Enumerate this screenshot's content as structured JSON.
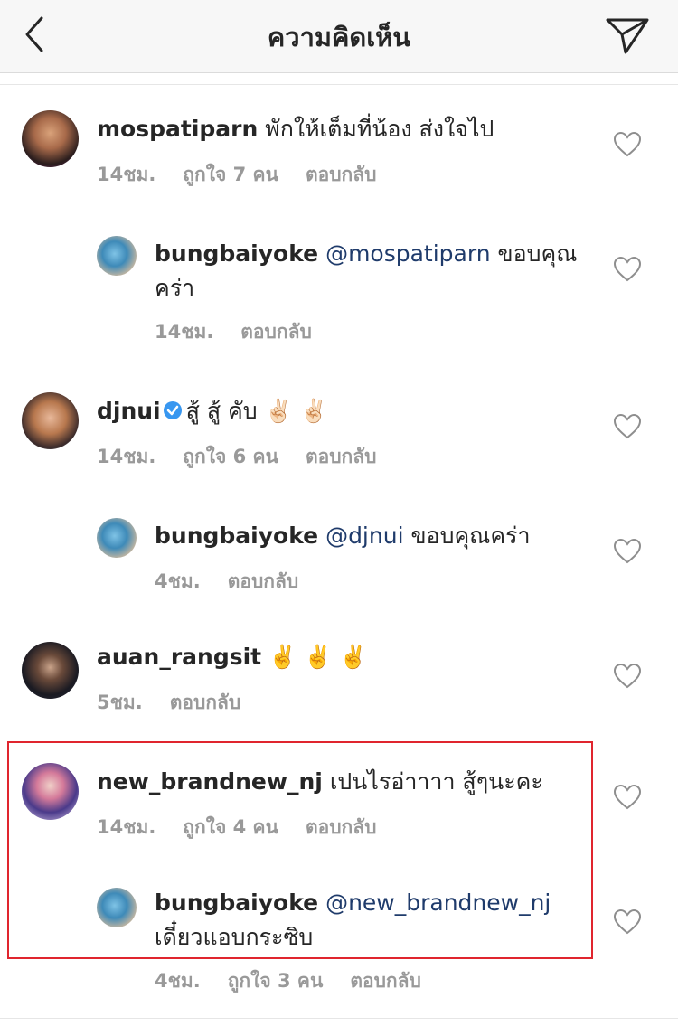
{
  "header": {
    "title": "ความคิดเห็น",
    "back_icon": "chevron-left-icon",
    "send_icon": "paper-plane-icon"
  },
  "comments": [
    {
      "username": "mospatiparn",
      "text": "พักให้เต็มที่น้อง ส่งใจไป",
      "time": "14ชม.",
      "likes": "ถูกใจ 7 คน",
      "reply": "ตอบกลับ"
    },
    {
      "username": "bungbaiyoke",
      "mention": "@mospatiparn",
      "text": "ขอบคุณคร่า",
      "time": "14ชม.",
      "reply": "ตอบกลับ"
    },
    {
      "username": "djnui",
      "verified": true,
      "text": "สู้ สู้ คับ ✌🏻 ✌🏻",
      "time": "14ชม.",
      "likes": "ถูกใจ 6 คน",
      "reply": "ตอบกลับ"
    },
    {
      "username": "bungbaiyoke",
      "mention": "@djnui",
      "text": "ขอบคุณคร่า",
      "time": "4ชม.",
      "reply": "ตอบกลับ"
    },
    {
      "username": "auan_rangsit",
      "text": "✌️ ✌️ ✌️",
      "time": "5ชม.",
      "reply": "ตอบกลับ"
    },
    {
      "username": "new_brandnew_nj",
      "text": "เปนไรอ่าาาา สู้ๆนะคะ",
      "time": "14ชม.",
      "likes": "ถูกใจ 4 คน",
      "reply": "ตอบกลับ"
    },
    {
      "username": "bungbaiyoke",
      "mention": "@new_brandnew_nj",
      "text": "เดี๋ยวแอบกระซิบ",
      "time": "4ชม.",
      "likes": "ถูกใจ 3 คน",
      "reply": "ตอบกลับ"
    }
  ],
  "colors": {
    "highlight": "#e0252e",
    "mention": "#1f3b6b",
    "meta": "#999999",
    "verified": "#3897f0"
  }
}
